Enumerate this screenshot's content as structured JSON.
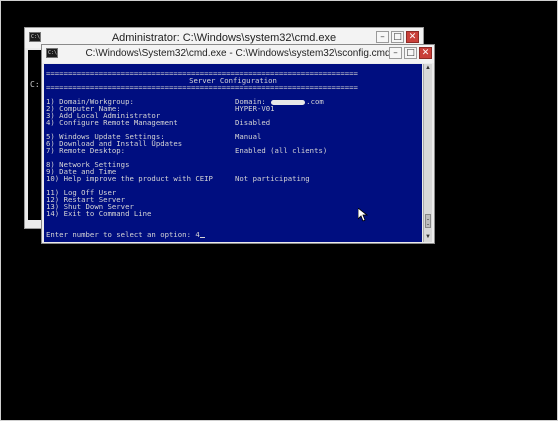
{
  "back_window": {
    "title": "Administrator: C:\\Windows\\system32\\cmd.exe",
    "icon_text": "C:\\",
    "console_text": "C:",
    "buttons": {
      "minimize": "–",
      "maximize": "□",
      "close": "✕"
    }
  },
  "front_window": {
    "title": "C:\\Windows\\System32\\cmd.exe - C:\\Windows\\system32\\sconfig.cmd",
    "icon_text": "C:\\",
    "buttons": {
      "minimize": "–",
      "maximize": "□",
      "close": "✕"
    }
  },
  "console": {
    "rule": "=======================================================================",
    "heading": "Server Configuration",
    "menu": [
      {
        "label": "1) Domain/Workgroup:",
        "value_prefix": "Domain:",
        "value_suffix": ".com",
        "redacted": true
      },
      {
        "label": "2) Computer Name:",
        "value": "HYPER-V01"
      },
      {
        "label": "3) Add Local Administrator",
        "value": ""
      },
      {
        "label": "4) Configure Remote Management",
        "value": "Disabled"
      },
      {
        "label": "5) Windows Update Settings:",
        "value": "Manual"
      },
      {
        "label": "6) Download and Install Updates",
        "value": ""
      },
      {
        "label": "7) Remote Desktop:",
        "value": "Enabled (all clients)"
      },
      {
        "label": "8) Network Settings",
        "value": ""
      },
      {
        "label": "9) Date and Time",
        "value": ""
      },
      {
        "label": "10) Help improve the product with CEIP",
        "value": "Not participating"
      },
      {
        "label": "11) Log Off User",
        "value": ""
      },
      {
        "label": "12) Restart Server",
        "value": ""
      },
      {
        "label": "13) Shut Down Server",
        "value": ""
      },
      {
        "label": "14) Exit to Command Line",
        "value": ""
      }
    ],
    "prompt": "Enter number to select an option: 4"
  },
  "colors": {
    "console_bg": "#000e80",
    "console_text": "#d6d6d6",
    "close_button": "#c9403a",
    "desktop": "#000000"
  }
}
